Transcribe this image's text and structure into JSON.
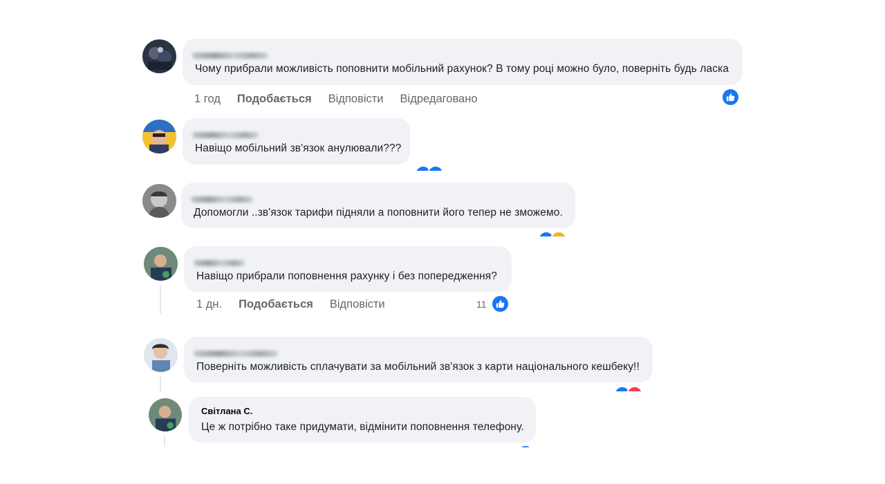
{
  "comments": [
    {
      "author": "",
      "text": "Чому прибрали можливість поповнити мобільний рахунок? В тому році можно було, поверніть будь ласка",
      "time": "1 год",
      "like_label": "Подобається",
      "reply_label": "Відповісти",
      "edited_label": "Відредаговано",
      "reaction_count": ""
    },
    {
      "author": "",
      "text": "Навіщо мобільний зв'язок анулювали???"
    },
    {
      "author": "",
      "text": "Допомогли ..зв'язок тарифи підняли а поповнити його тепер не зможемо."
    },
    {
      "author": "",
      "text": "Навіщо прибрали поповнення рахунку і без попередження?",
      "time": "1 дн.",
      "like_label": "Подобається",
      "reply_label": "Відповісти",
      "reaction_count": "11"
    },
    {
      "author": "",
      "text": "Поверніть можливість сплачувати за мобільний зв'язок з карти національного кешбеку!!"
    },
    {
      "author": "Світлана С.",
      "text": "Це ж потрібно таке придумати, відмінити поповнення телефону."
    }
  ],
  "colors": {
    "bubble": "#f0f2f5",
    "like_blue": "#1877f2",
    "meta_text": "#65676b",
    "love_red": "#f33e58",
    "care_orange": "#f7b125"
  },
  "icons": {
    "like": "thumbs-up-icon"
  }
}
